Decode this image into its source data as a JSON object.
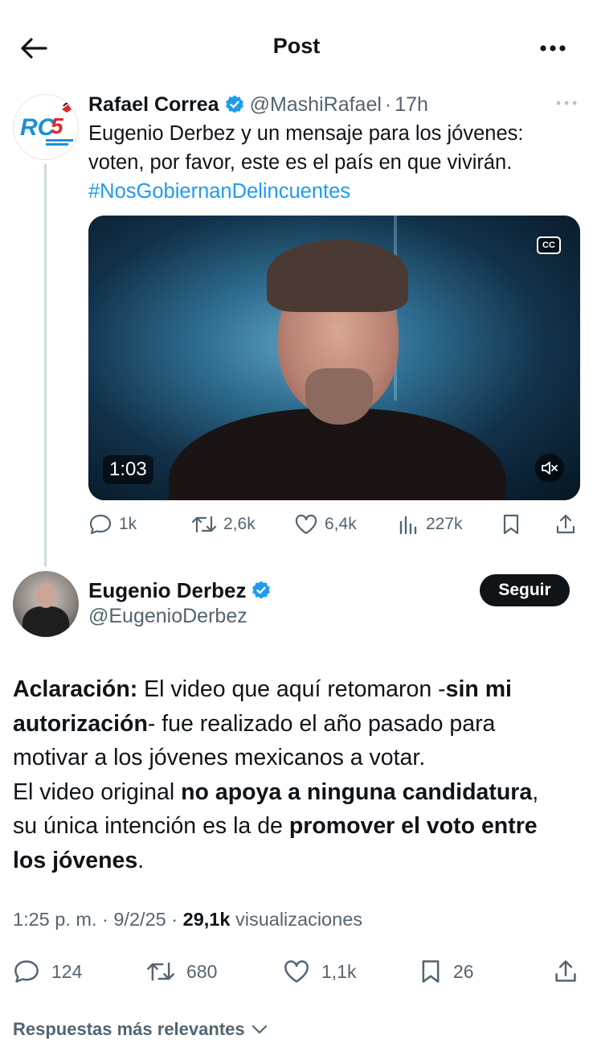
{
  "header": {
    "title": "Post",
    "back_icon": "arrow-left-icon",
    "more_icon": "more-horizontal-icon"
  },
  "parent_post": {
    "author_name": "Rafael Correa",
    "verified": true,
    "handle": "@MashiRafael",
    "time": "17h",
    "text": "Eugenio Derbez y un mensaje para los jóvenes: voten, por favor, este es el país en que vivirán.",
    "hashtag": "#NosGobiernanDelincuentes",
    "video": {
      "duration": "1:03",
      "cc_label": "CC"
    },
    "stats": {
      "replies": "1k",
      "reposts": "2,6k",
      "likes": "6,4k",
      "views": "227k"
    }
  },
  "main_post": {
    "author_name": "Eugenio Derbez",
    "verified": true,
    "handle": "@EugenioDerbez",
    "follow_label": "Seguir",
    "text": {
      "p1_bold1": "Aclaración:",
      "p1_text1": " El video que aquí retomaron -",
      "p1_bold2": "sin mi",
      "p1_bold3": "autorización",
      "p1_text2": "- fue realizado el año pasado para",
      "p1_text3": "motivar a los jóvenes mexicanos a votar.",
      "p2_text1": "El video original ",
      "p2_bold1": "no apoya a ninguna candidatura",
      "p2_text2": ",",
      "p3_text1": "su única intención es la de ",
      "p3_bold1": "promover el voto entre",
      "p4_bold1": "los jóvenes",
      "p4_text1": "."
    },
    "meta": {
      "time": "1:25 p. m.",
      "date": "9/2/25",
      "views_count": "29,1k",
      "views_label": "visualizaciones"
    },
    "stats": {
      "replies": "124",
      "reposts": "680",
      "likes": "1,1k",
      "bookmarks": "26"
    }
  },
  "replies_sort": {
    "label": "Respuestas más relevantes"
  },
  "colors": {
    "accent": "#1d9bf0",
    "text": "#0f1419",
    "muted": "#536471"
  }
}
